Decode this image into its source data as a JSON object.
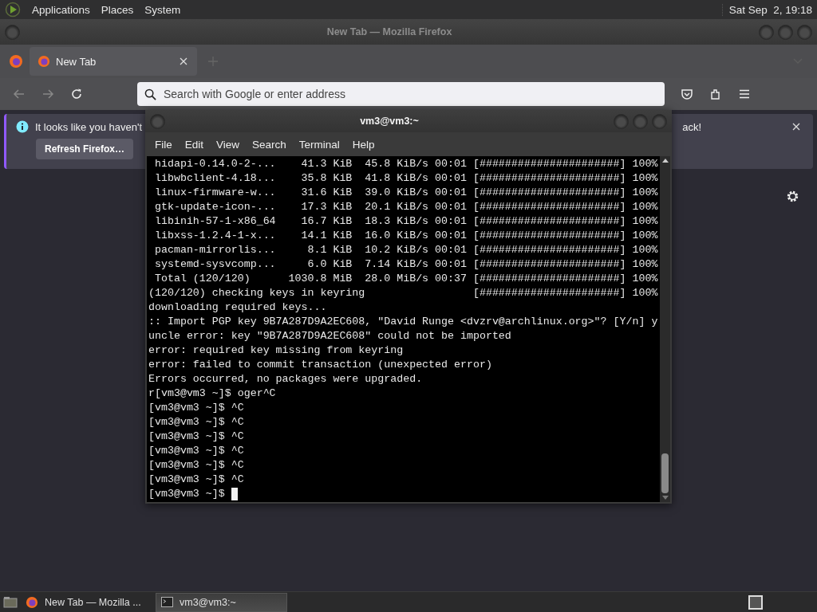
{
  "top_panel": {
    "menus": [
      "Applications",
      "Places",
      "System"
    ],
    "clock": "Sat Sep  2, 19:18"
  },
  "firefox": {
    "title": "New Tab — Mozilla Firefox",
    "tabs": [
      {
        "label": "New Tab",
        "selected": true
      }
    ],
    "address_bar": {
      "placeholder": "Search with Google or enter address"
    },
    "notification": {
      "text_left": "It looks like you haven't",
      "text_right": "ack!",
      "button": "Refresh Firefox…"
    }
  },
  "terminal": {
    "title": "vm3@vm3:~",
    "menu": [
      "File",
      "Edit",
      "View",
      "Search",
      "Terminal",
      "Help"
    ],
    "lines": [
      " hidapi-0.14.0-2-...    41.3 KiB  45.8 KiB/s 00:01 [######################] 100%",
      " libwbclient-4.18...    35.8 KiB  41.8 KiB/s 00:01 [######################] 100%",
      " linux-firmware-w...    31.6 KiB  39.0 KiB/s 00:01 [######################] 100%",
      " gtk-update-icon-...    17.3 KiB  20.1 KiB/s 00:01 [######################] 100%",
      " libinih-57-1-x86_64    16.7 KiB  18.3 KiB/s 00:01 [######################] 100%",
      " libxss-1.2.4-1-x...    14.1 KiB  16.0 KiB/s 00:01 [######################] 100%",
      " pacman-mirrorlis...     8.1 KiB  10.2 KiB/s 00:01 [######################] 100%",
      " systemd-sysvcomp...     6.0 KiB  7.14 KiB/s 00:01 [######################] 100%",
      " Total (120/120)      1030.8 MiB  28.0 MiB/s 00:37 [######################] 100%",
      "(120/120) checking keys in keyring                 [######################] 100%",
      "downloading required keys...",
      ":: Import PGP key 9B7A287D9A2EC608, \"David Runge <dvzrv@archlinux.org>\"? [Y/n] y",
      "uncle error: key \"9B7A287D9A2EC608\" could not be imported",
      "error: required key missing from keyring",
      "error: failed to commit transaction (unexpected error)",
      "Errors occurred, no packages were upgraded.",
      "r[vm3@vm3 ~]$ oger^C",
      "[vm3@vm3 ~]$ ^C",
      "[vm3@vm3 ~]$ ^C",
      "[vm3@vm3 ~]$ ^C",
      "[vm3@vm3 ~]$ ^C",
      "[vm3@vm3 ~]$ ^C",
      "[vm3@vm3 ~]$ ^C"
    ],
    "prompt": "[vm3@vm3 ~]$ "
  },
  "taskbar": {
    "items": [
      {
        "label": "New Tab — Mozilla ...",
        "kind": "browser",
        "selected": false
      },
      {
        "label": "vm3@vm3:~",
        "kind": "terminal",
        "selected": true
      }
    ]
  }
}
